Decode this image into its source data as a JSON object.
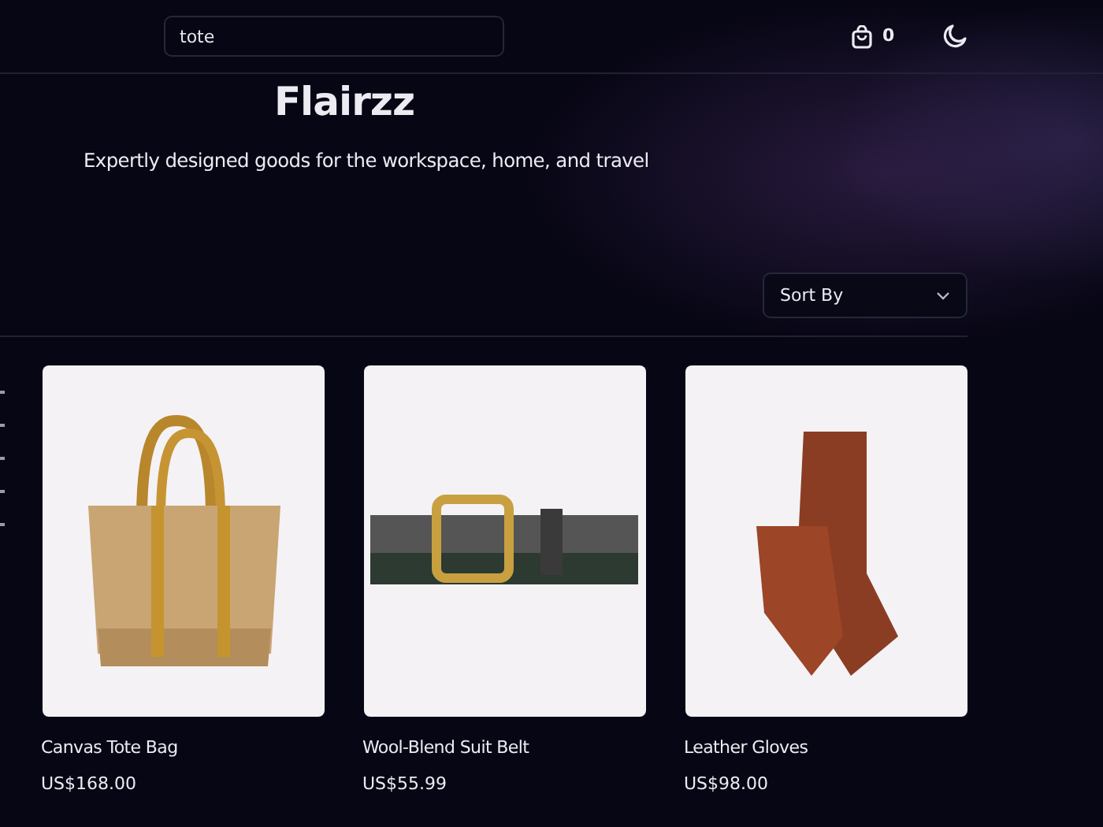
{
  "header": {
    "search": {
      "value": "tote"
    },
    "cart_count": "0"
  },
  "hero": {
    "title": "Flairzz",
    "subtitle": "Expertly designed goods for the workspace, home, and travel"
  },
  "sort": {
    "label": "Sort By"
  },
  "products": [
    {
      "kind": "tote",
      "name": "Canvas Tote Bag",
      "price": "US$168.00"
    },
    {
      "kind": "belt",
      "name": "Wool-Blend Suit Belt",
      "price": "US$55.99"
    },
    {
      "kind": "gloves",
      "name": "Leather Gloves",
      "price": "US$98.00"
    }
  ]
}
